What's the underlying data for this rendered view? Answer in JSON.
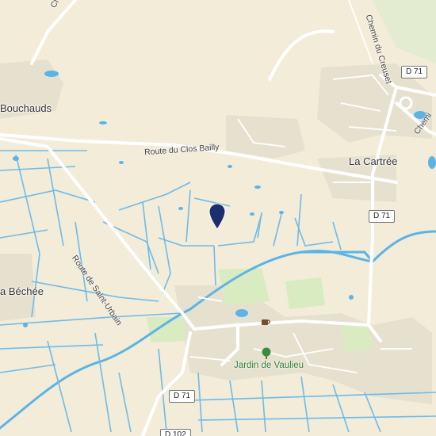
{
  "colors": {
    "land": "#f2ecd9",
    "water": "#5bb3e6",
    "road": "#ffffff",
    "park": "#d9ebc0",
    "built": "#e6e1cf",
    "pin": "#1a2f6b"
  },
  "places": {
    "bouchauds": "Bouchauds",
    "cartree": "La Cartrée",
    "bechee": "a Béchée"
  },
  "roads": {
    "clos_bailly": "Route du Clos Bailly",
    "saint_urbain": "Route de Saint-Urbain",
    "creuset": "Chemin du Creuset",
    "chemin_edge": "Chemi",
    "ch_top": "Ch"
  },
  "shields": {
    "d71_top": "D 71",
    "d71_mid": "D 71",
    "d71_bottom": "D 71",
    "d71_cut": "D 102"
  },
  "poi": {
    "jardin": "Jardin de Vaulieu",
    "park_icon": "tree-icon",
    "cafe_icon": "cafe-icon"
  },
  "marker": {
    "icon": "location-pin-icon"
  }
}
